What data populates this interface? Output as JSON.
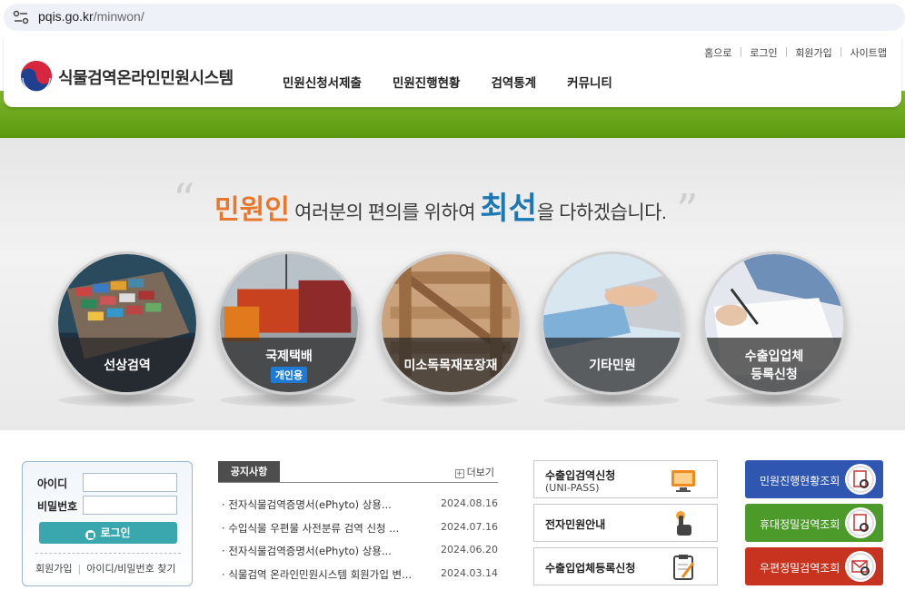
{
  "browser": {
    "url_domain": "pqis.go.kr",
    "url_path": "/minwon/"
  },
  "header": {
    "site_title": "식물검역온라인민원시스템",
    "util_links": [
      "홈으로",
      "로그인",
      "회원가입",
      "사이트맵"
    ],
    "gnb": [
      "민원신청서제출",
      "민원진행현황",
      "검역통계",
      "커뮤니티"
    ]
  },
  "banner": {
    "slogan_orange": "민원인",
    "slogan_gray_1": " 여러분의 편의를 위하여 ",
    "slogan_blue": "최선",
    "slogan_gray_2": "을 다하겠습니다.",
    "circles": [
      {
        "label": "선상검역"
      },
      {
        "label": "국제택배",
        "badge": "개인용"
      },
      {
        "label": "미소독목재포장재"
      },
      {
        "label": "기타민원"
      },
      {
        "label_line1": "수출입업체",
        "label_line2": "등록신청"
      }
    ]
  },
  "login": {
    "id_label": "아이디",
    "pw_label": "비밀번호",
    "login_button": "로그인",
    "join_link": "회원가입",
    "find_link": "아이디/비밀번호 찾기"
  },
  "notice": {
    "tab": "공지사항",
    "more": "더보기",
    "items": [
      {
        "title": "전자식물검역증명서(ePhyto) 상용...",
        "date": "2024.08.16"
      },
      {
        "title": "수입식물 우편물 사전분류 검역 신청 ...",
        "date": "2024.07.16"
      },
      {
        "title": "전자식물검역증명서(ePhyto) 상용...",
        "date": "2024.06.20"
      },
      {
        "title": "식물검역 온라인민원시스템 회원가입 변...",
        "date": "2024.03.14"
      }
    ]
  },
  "services": [
    {
      "title": "수출입검역신청",
      "sub": "(UNI-PASS)",
      "icon": "monitor-icon"
    },
    {
      "title": "전자민원안내",
      "icon": "touch-hand-icon"
    },
    {
      "title": "수출입업체등록신청",
      "icon": "clipboard-pen-icon"
    }
  ],
  "quick": [
    {
      "label": "민원진행현황조회",
      "color": "#2f56b0",
      "icon": "document-search-icon"
    },
    {
      "label": "휴대정밀검역조회",
      "color": "#4b9a2a",
      "icon": "document-search-icon"
    },
    {
      "label": "우편정밀검역조회",
      "color": "#c8331f",
      "icon": "envelope-search-icon"
    }
  ]
}
